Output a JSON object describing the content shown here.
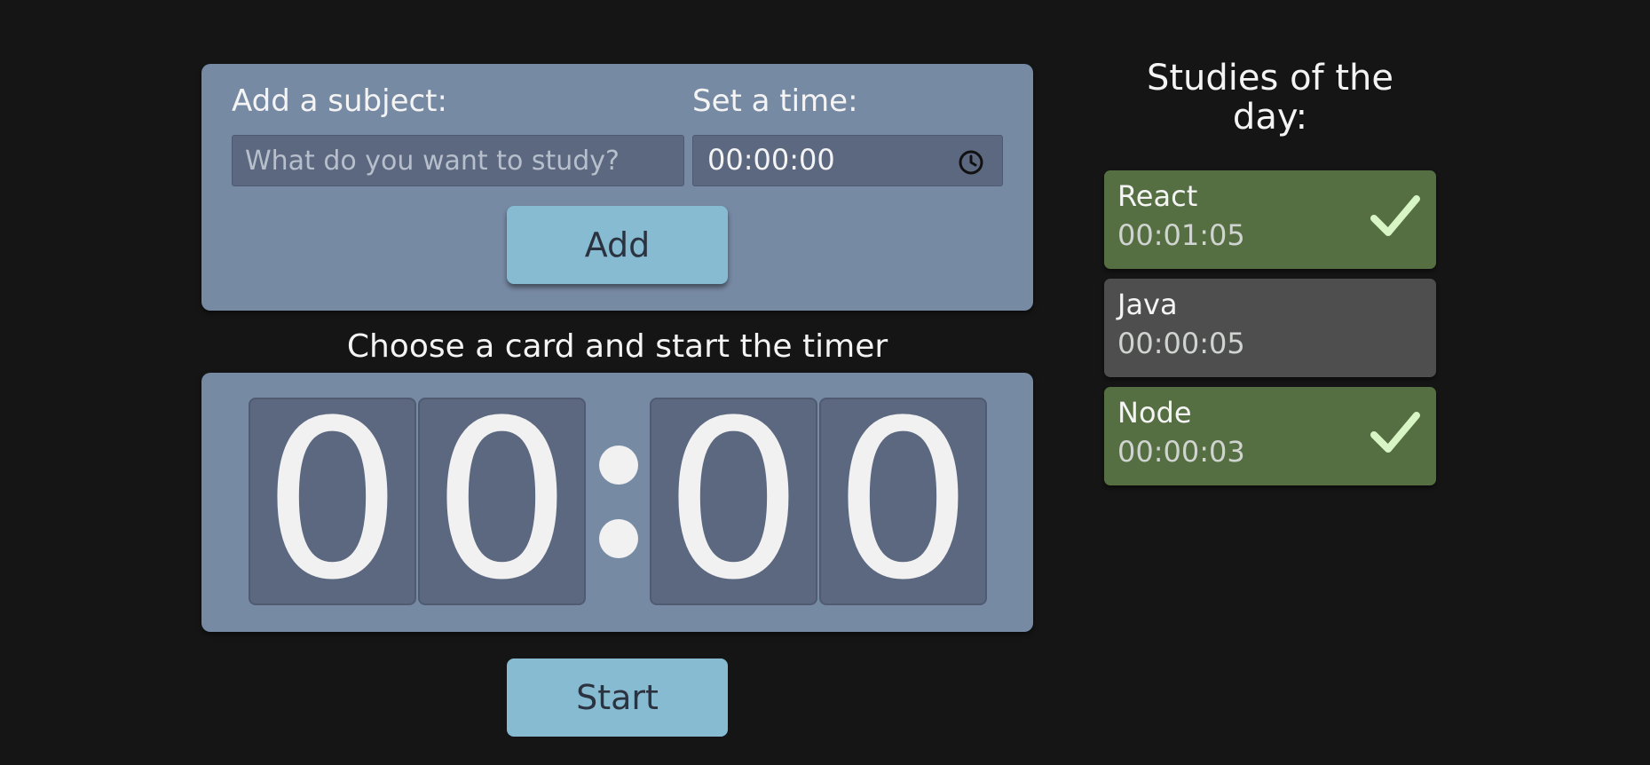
{
  "form": {
    "subject_label": "Add a subject:",
    "subject_placeholder": "What do you want to study?",
    "subject_value": "",
    "time_label": "Set a time:",
    "time_value": "00:00:00",
    "time_icon": "clock-icon",
    "add_label": "Add"
  },
  "timer": {
    "heading": "Choose a card and start the timer",
    "digits": [
      "0",
      "0",
      "0",
      "0"
    ],
    "start_label": "Start"
  },
  "studies": {
    "title": "Studies of the day:",
    "items": [
      {
        "name": "React",
        "time": "00:01:05",
        "completed": true
      },
      {
        "name": "Java",
        "time": "00:00:05",
        "completed": false
      },
      {
        "name": "Node",
        "time": "00:00:03",
        "completed": true
      }
    ]
  },
  "colors": {
    "background": "#151515",
    "panel": "#778aa4",
    "input": "#5c6880",
    "button": "#87bbd2",
    "card_done": "#566f42",
    "card_pending": "#4e4e4e",
    "check": "#d7f5c5"
  }
}
